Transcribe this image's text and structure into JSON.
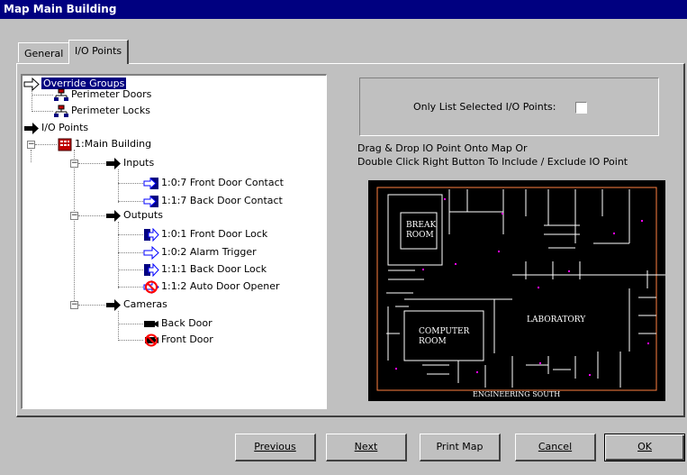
{
  "window": {
    "title": "Map Main Building"
  },
  "tabs": [
    {
      "label": "General",
      "active": false
    },
    {
      "label": "I/O Points",
      "active": true
    }
  ],
  "tree": {
    "override_groups": {
      "label": "Override Groups",
      "selected": true
    },
    "perimeter_doors": {
      "label": "Perimeter Doors"
    },
    "perimeter_locks": {
      "label": "Perimeter Locks"
    },
    "io_points": {
      "label": "I/O Points"
    },
    "main_building": {
      "label": "1:Main Building"
    },
    "inputs": {
      "label": "Inputs"
    },
    "front_door_contact": {
      "label": "1:0:7  Front Door Contact"
    },
    "back_door_contact": {
      "label": "1:1:7  Back Door Contact"
    },
    "outputs": {
      "label": "Outputs"
    },
    "front_door_lock": {
      "label": "1:0:1  Front Door Lock"
    },
    "alarm_trigger": {
      "label": "1:0:2  Alarm Trigger"
    },
    "back_door_lock": {
      "label": "1:1:1  Back Door Lock"
    },
    "auto_door_opener": {
      "label": "1:1:2  Auto Door Opener"
    },
    "cameras": {
      "label": "Cameras"
    },
    "back_door_camera": {
      "label": "Back Door"
    },
    "front_door_camera": {
      "label": "Front Door"
    }
  },
  "options": {
    "only_list_selected_label": "Only List Selected I/O Points:",
    "only_list_selected_checked": false
  },
  "instructions": {
    "line1": "Drag & Drop IO Point Onto Map Or",
    "line2": "Double Click Right Button To Include / Exclude IO Point"
  },
  "map": {
    "labels": {
      "break_room_1": "BREAK",
      "break_room_2": "ROOM",
      "computer_room_1": "COMPUTER",
      "computer_room_2": "ROOM",
      "laboratory": "LABORATORY",
      "engineering": "ENGINEERING SOUTH"
    }
  },
  "buttons": {
    "previous": "Previous",
    "next": "Next",
    "print_map": "Print Map",
    "cancel": "Cancel",
    "ok": "OK"
  },
  "colors": {
    "titlebar": "#000080",
    "face": "#c0c0c0",
    "selection": "#000080",
    "map_bg": "#000000",
    "map_lines": "#ffffff",
    "map_accent": "#ff8040"
  }
}
